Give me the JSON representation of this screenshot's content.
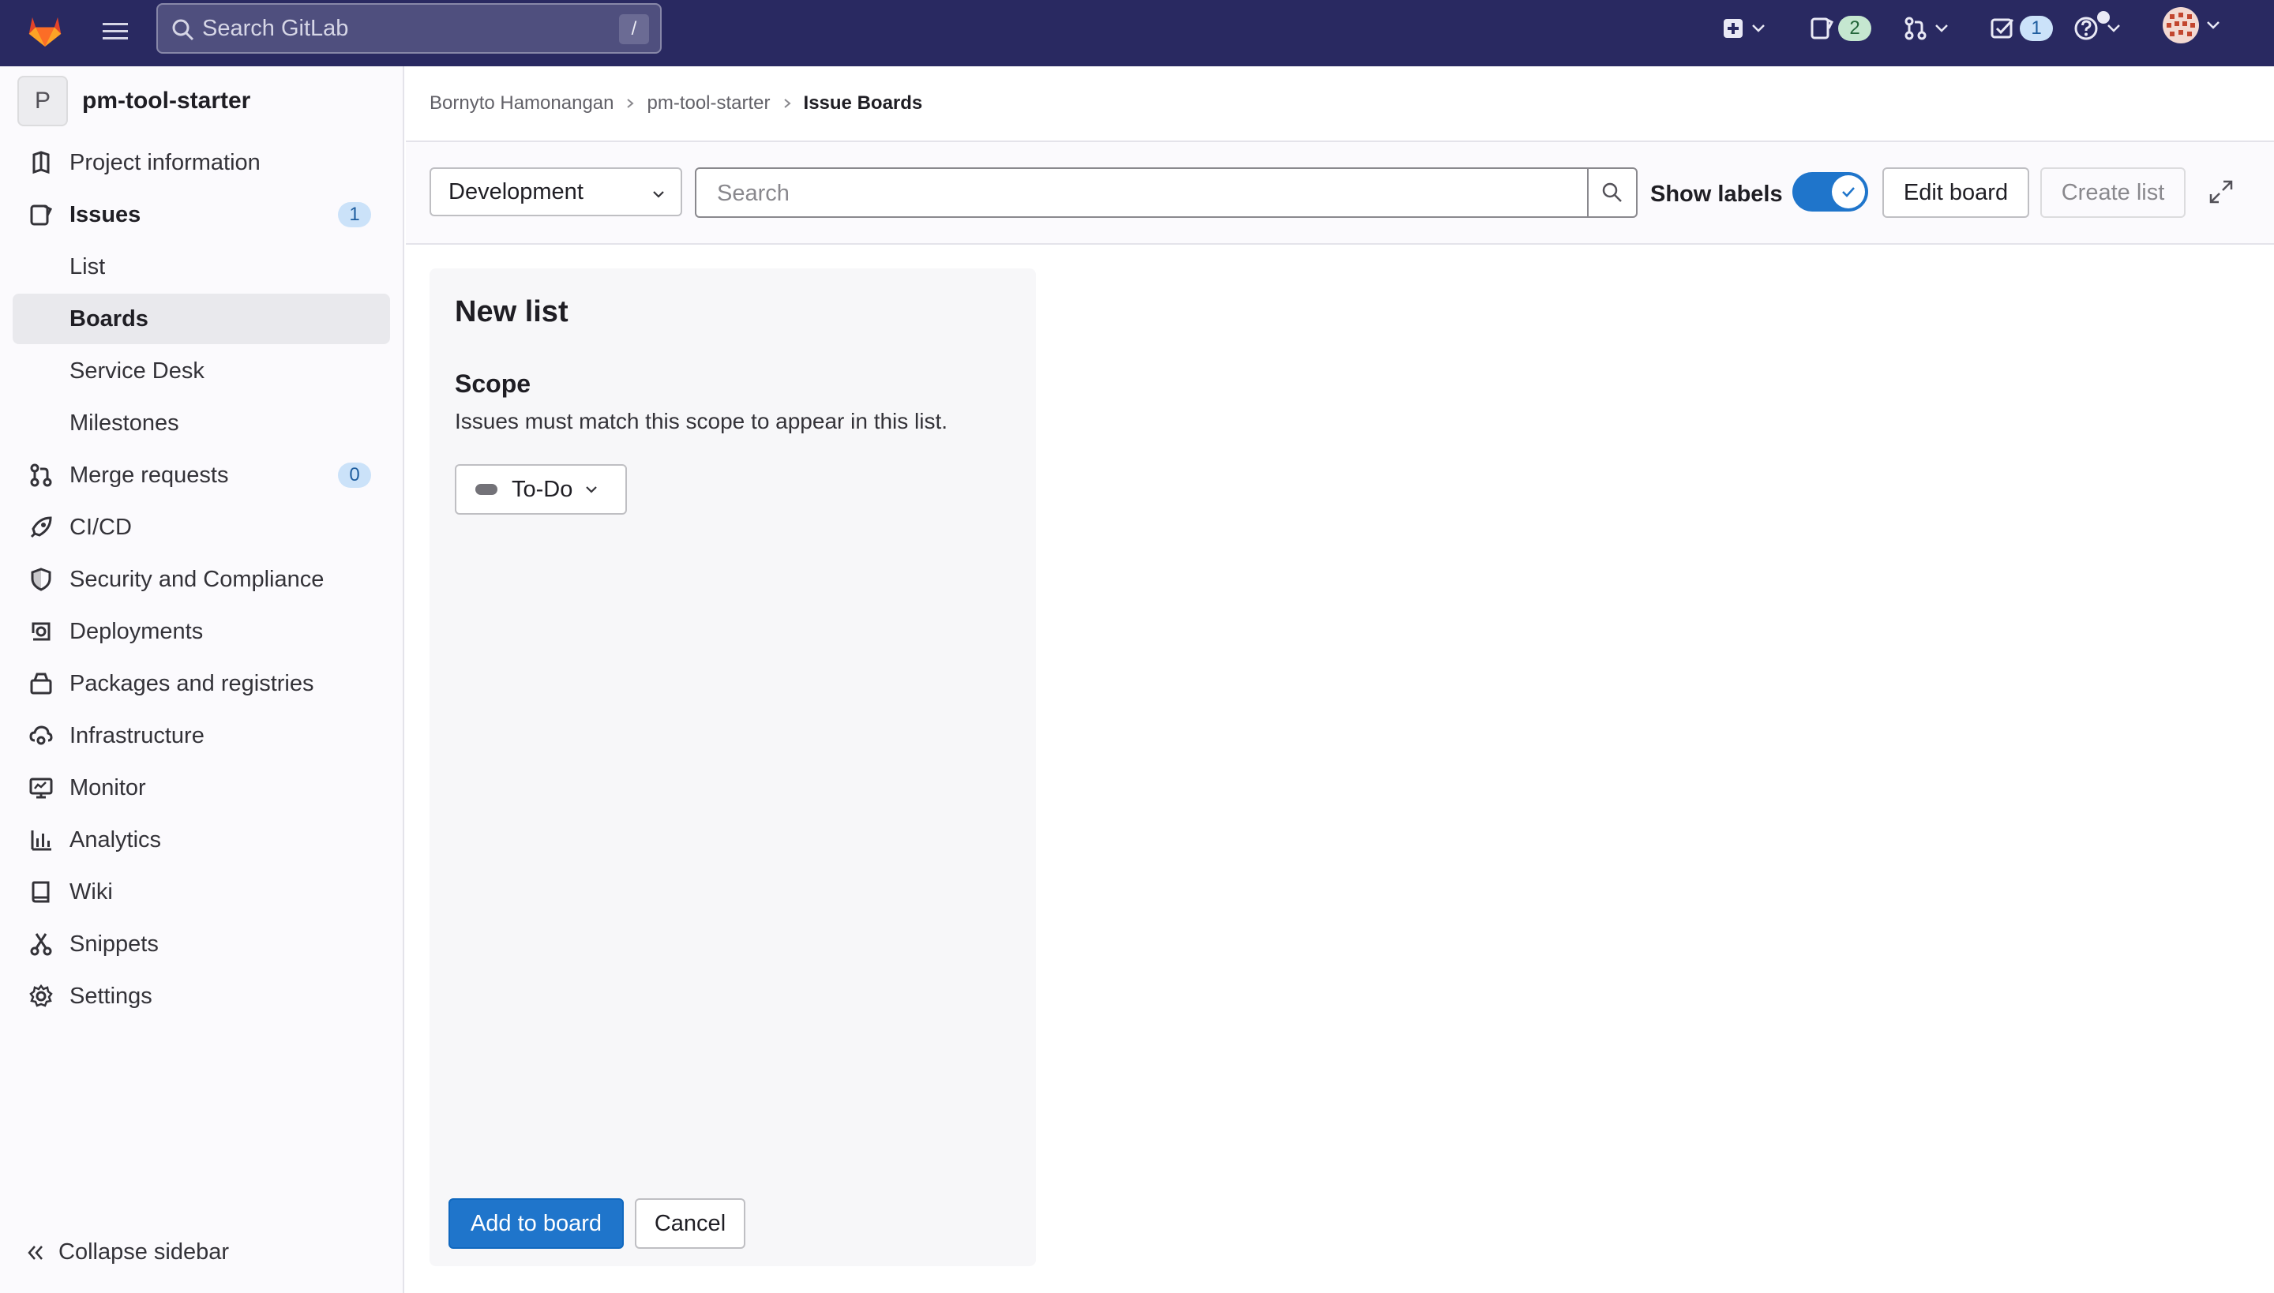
{
  "topbar": {
    "search_placeholder": "Search GitLab",
    "search_shortcut": "/",
    "issues_count": "2",
    "todos_count": "1"
  },
  "sidebar": {
    "project_avatar": "P",
    "project_name": "pm-tool-starter",
    "items": [
      {
        "label": "Project information",
        "icon": "project-info-icon"
      },
      {
        "label": "Issues",
        "icon": "issues-icon",
        "count": "1"
      },
      {
        "label": "List"
      },
      {
        "label": "Boards"
      },
      {
        "label": "Service Desk"
      },
      {
        "label": "Milestones"
      },
      {
        "label": "Merge requests",
        "icon": "merge-request-icon",
        "count": "0"
      },
      {
        "label": "CI/CD",
        "icon": "rocket-icon"
      },
      {
        "label": "Security and Compliance",
        "icon": "shield-icon"
      },
      {
        "label": "Deployments",
        "icon": "deployments-icon"
      },
      {
        "label": "Packages and registries",
        "icon": "package-icon"
      },
      {
        "label": "Infrastructure",
        "icon": "cloud-gear-icon"
      },
      {
        "label": "Monitor",
        "icon": "monitor-icon"
      },
      {
        "label": "Analytics",
        "icon": "chart-icon"
      },
      {
        "label": "Wiki",
        "icon": "book-icon"
      },
      {
        "label": "Snippets",
        "icon": "scissors-icon"
      },
      {
        "label": "Settings",
        "icon": "gear-icon"
      }
    ],
    "collapse_label": "Collapse sidebar"
  },
  "breadcrumb": {
    "items": [
      "Bornyto Hamonangan",
      "pm-tool-starter",
      "Issue Boards"
    ]
  },
  "filterbar": {
    "board_name": "Development",
    "search_placeholder": "Search",
    "show_labels": "Show labels",
    "show_labels_on": true,
    "edit_board": "Edit board",
    "create_list": "Create list"
  },
  "new_list": {
    "title": "New list",
    "scope_heading": "Scope",
    "scope_description": "Issues must match this scope to appear in this list.",
    "scope_value": "To-Do",
    "add_button": "Add to board",
    "cancel_button": "Cancel"
  },
  "colors": {
    "navbar": "#292961",
    "primary": "#1f75cb",
    "sidebar_active": "#e9e9ed"
  }
}
